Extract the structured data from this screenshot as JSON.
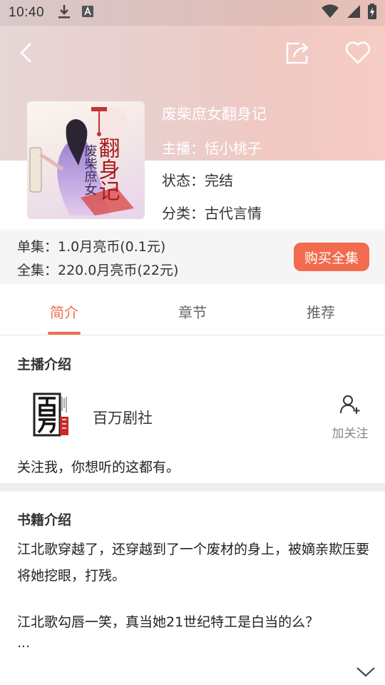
{
  "status_bar": {
    "time": "10:40"
  },
  "book": {
    "title": "废柴庶女翻身记",
    "cover_text": "翻身记",
    "cover_subtitle": "废柴庶女",
    "host_label": "主播：",
    "host_value": "恬小桃子",
    "status_label": "状态：",
    "status_value": "完结",
    "category_label": "分类：",
    "category_value": "古代言情"
  },
  "price": {
    "single": "单集：1.0月亮币(0.1元)",
    "all": "全集：220.0月亮币(22元)",
    "buy_label": "购买全集"
  },
  "tabs": [
    {
      "label": "简介",
      "active": true
    },
    {
      "label": "章节",
      "active": false
    },
    {
      "label": "推荐",
      "active": false
    }
  ],
  "host_section": {
    "title": "主播介绍",
    "name": "百万剧社",
    "follow_label": "加关注",
    "description": "关注我，你想听的这都有。"
  },
  "book_section": {
    "title": "书籍介绍",
    "paragraph1": "江北歌穿越了，还穿越到了一个废材的身上，被嫡亲欺压要将她挖眼，打残。",
    "paragraph2": "江北歌勾唇一笑，真当她21世纪特工是白当的么？",
    "ellipsis": "..."
  },
  "colors": {
    "accent": "#f26b4e",
    "price_bg": "#f5f5f5",
    "header_bg": "#ebd2d0"
  },
  "icons": [
    "download-icon",
    "font-a-icon",
    "wifi-icon",
    "signal-icon",
    "battery-icon",
    "back-arrow-icon",
    "share-icon",
    "heart-icon",
    "add-user-icon",
    "chevron-down-icon"
  ]
}
